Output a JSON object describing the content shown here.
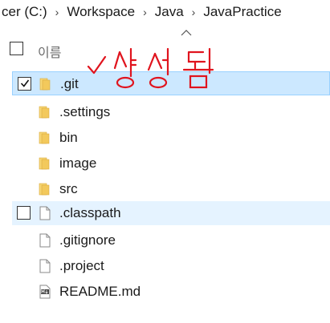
{
  "breadcrumb": {
    "items": [
      "cer (C:)",
      "Workspace",
      "Java",
      "JavaPractice"
    ],
    "separator": "›"
  },
  "header": {
    "name_label": "이름"
  },
  "files": [
    {
      "name": ".git",
      "type": "folder",
      "selected": true
    },
    {
      "name": ".settings",
      "type": "folder"
    },
    {
      "name": "bin",
      "type": "folder"
    },
    {
      "name": "image",
      "type": "folder"
    },
    {
      "name": "src",
      "type": "folder"
    },
    {
      "name": ".classpath",
      "type": "file",
      "hover": true
    },
    {
      "name": ".gitignore",
      "type": "file"
    },
    {
      "name": ".project",
      "type": "file"
    },
    {
      "name": "README.md",
      "type": "markdown-file"
    }
  ],
  "annotation": {
    "text": "✓ 생성됨",
    "color": "#e0141e"
  },
  "colors": {
    "selected_bg": "#cce8ff",
    "hover_bg": "#e5f3ff",
    "folder": "#e8b84a"
  }
}
